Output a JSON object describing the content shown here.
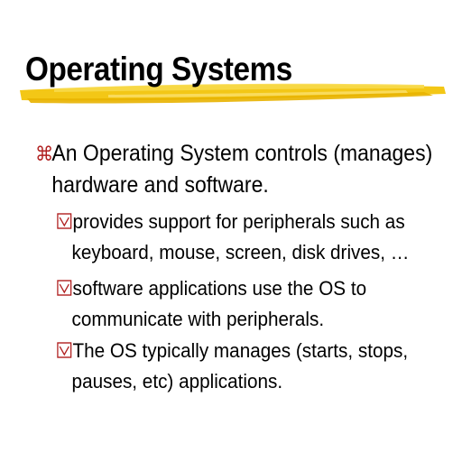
{
  "slide": {
    "title": "Operating Systems",
    "accent_color": "#f2c40a",
    "bullet_color": "#b02020",
    "points": [
      {
        "bullet_icon": "command-key-icon",
        "lines": [
          "An Operating System controls (manages)",
          "hardware and software."
        ]
      }
    ],
    "sub_points": [
      {
        "bullet_icon": "checkbox-icon",
        "lines": [
          "provides support for peripherals such as",
          "keyboard, mouse, screen, disk drives, …"
        ]
      },
      {
        "bullet_icon": "checkbox-icon",
        "lines": [
          "software applications use the OS to",
          "communicate with peripherals."
        ]
      },
      {
        "bullet_icon": "checkbox-icon",
        "lines": [
          "The OS typically manages (starts, stops,",
          "pauses, etc) applications."
        ]
      }
    ]
  }
}
